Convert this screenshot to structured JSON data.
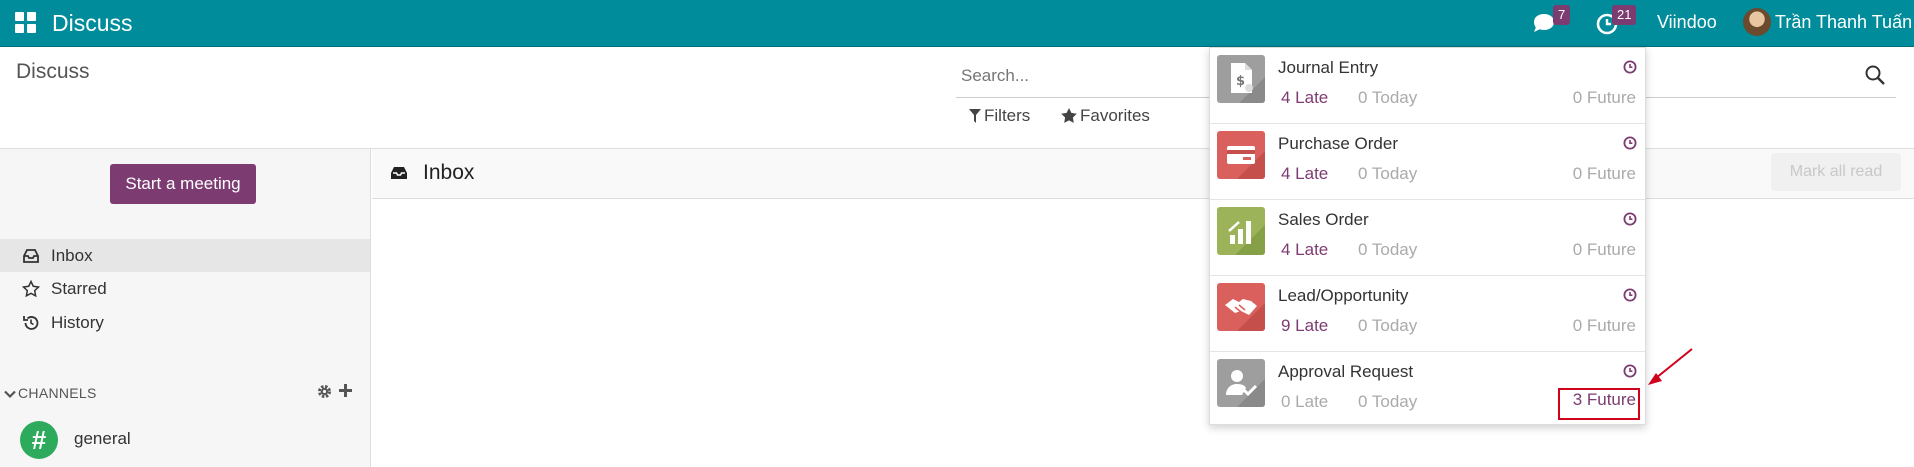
{
  "navbar": {
    "app_title": "Discuss",
    "chat_badge": "7",
    "activity_badge": "21",
    "company": "Viindoo",
    "user_name": "Trần Thanh Tuấn",
    "background_color": "#008c9a"
  },
  "control_panel": {
    "title": "Discuss",
    "search_placeholder": "Search...",
    "filters_label": "Filters",
    "favorites_label": "Favorites"
  },
  "sidebar": {
    "start_meeting_label": "Start a meeting",
    "items": [
      {
        "label": "Inbox",
        "icon": "inbox-icon",
        "active": true
      },
      {
        "label": "Starred",
        "icon": "star-icon",
        "active": false
      },
      {
        "label": "History",
        "icon": "history-icon",
        "active": false
      }
    ],
    "channels_label": "CHANNELS",
    "channels": [
      {
        "label": "general",
        "icon": "hash-icon"
      }
    ]
  },
  "main": {
    "title": "Inbox",
    "mark_all_read_label": "Mark all read"
  },
  "activities": [
    {
      "name": "Journal Entry",
      "late": "4 Late",
      "today": "0 Today",
      "future": "0 Future",
      "icon": "journal-entry-icon",
      "color": "#9e9e9e"
    },
    {
      "name": "Purchase Order",
      "late": "4 Late",
      "today": "0 Today",
      "future": "0 Future",
      "icon": "purchase-order-icon",
      "color": "#d9605c"
    },
    {
      "name": "Sales Order",
      "late": "4 Late",
      "today": "0 Today",
      "future": "0 Future",
      "icon": "sales-order-icon",
      "color": "#9cb35a"
    },
    {
      "name": "Lead/Opportunity",
      "late": "9 Late",
      "today": "0 Today",
      "future": "0 Future",
      "icon": "lead-opportunity-icon",
      "color": "#d9605c"
    },
    {
      "name": "Approval Request",
      "late": "0 Late",
      "today": "0 Today",
      "future": "3 Future",
      "icon": "approval-request-icon",
      "color": "#9e9e9e"
    }
  ],
  "colors": {
    "accent": "#7c3c72",
    "annotation": "#d0021b"
  }
}
